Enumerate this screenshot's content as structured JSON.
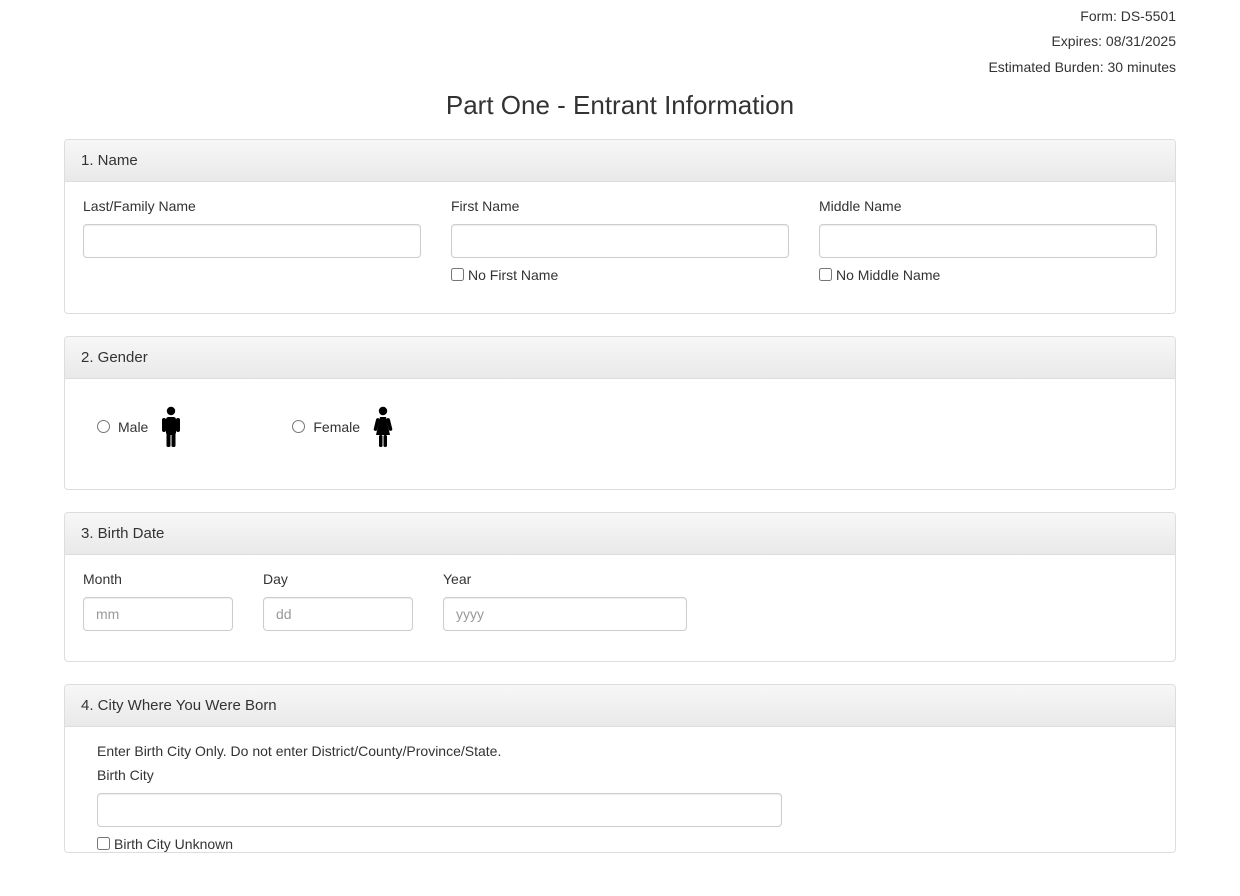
{
  "meta": {
    "form": "Form: DS-5501",
    "expires": "Expires: 08/31/2025",
    "burden": "Estimated Burden: 30 minutes"
  },
  "title": "Part One - Entrant Information",
  "section1": {
    "heading": "1. Name",
    "lastName": {
      "label": "Last/Family Name"
    },
    "firstName": {
      "label": "First Name",
      "noFirstName": "No First Name"
    },
    "middleName": {
      "label": "Middle Name",
      "noMiddleName": "No Middle Name"
    }
  },
  "section2": {
    "heading": "2. Gender",
    "male": "Male",
    "female": "Female"
  },
  "section3": {
    "heading": "3. Birth Date",
    "month": {
      "label": "Month",
      "placeholder": "mm"
    },
    "day": {
      "label": "Day",
      "placeholder": "dd"
    },
    "year": {
      "label": "Year",
      "placeholder": "yyyy"
    }
  },
  "section4": {
    "heading": "4. City Where You Were Born",
    "instruction": "Enter Birth City Only. Do not enter District/County/Province/State.",
    "label": "Birth City",
    "unknown": "Birth City Unknown"
  }
}
